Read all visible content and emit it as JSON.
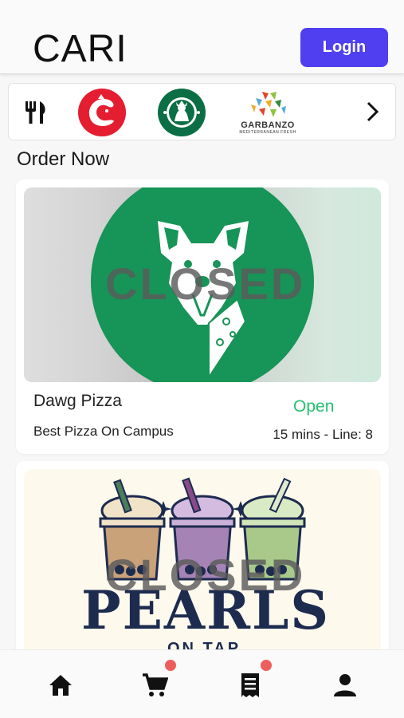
{
  "header": {
    "app_title": "CARI",
    "login_label": "Login"
  },
  "restaurant_strip": {
    "items": [
      {
        "name": "all-restaurants",
        "icon": "fork-knife-icon"
      },
      {
        "name": "chick-fil-a",
        "icon": "chick-fil-a-logo"
      },
      {
        "name": "starbucks",
        "icon": "starbucks-logo"
      },
      {
        "name": "garbanzo",
        "logo_text": "GARBANZO",
        "logo_subtext": "MEDITERRANEAN FRESH"
      }
    ],
    "next_icon": "chevron-right-icon"
  },
  "section_title": "Order Now",
  "cards": [
    {
      "overlay": "CLOSED",
      "name": "Dawg Pizza",
      "status": "Open",
      "tagline": "Best Pizza On Campus",
      "wait": "15 mins - Line: 8"
    },
    {
      "overlay": "CLOSED",
      "logo_title": "PEARLS",
      "logo_sub": "ON TAP"
    }
  ],
  "bottom_nav": {
    "items": [
      {
        "icon": "home-icon"
      },
      {
        "icon": "cart-icon",
        "badge": true
      },
      {
        "icon": "receipt-icon",
        "badge": true
      },
      {
        "icon": "person-icon"
      }
    ]
  },
  "colors": {
    "accent": "#4f3ff0",
    "open_status": "#25c26e",
    "badge": "#ee5d5d",
    "dawg_green": "#179457",
    "pearls_navy": "#1d2b4f"
  }
}
